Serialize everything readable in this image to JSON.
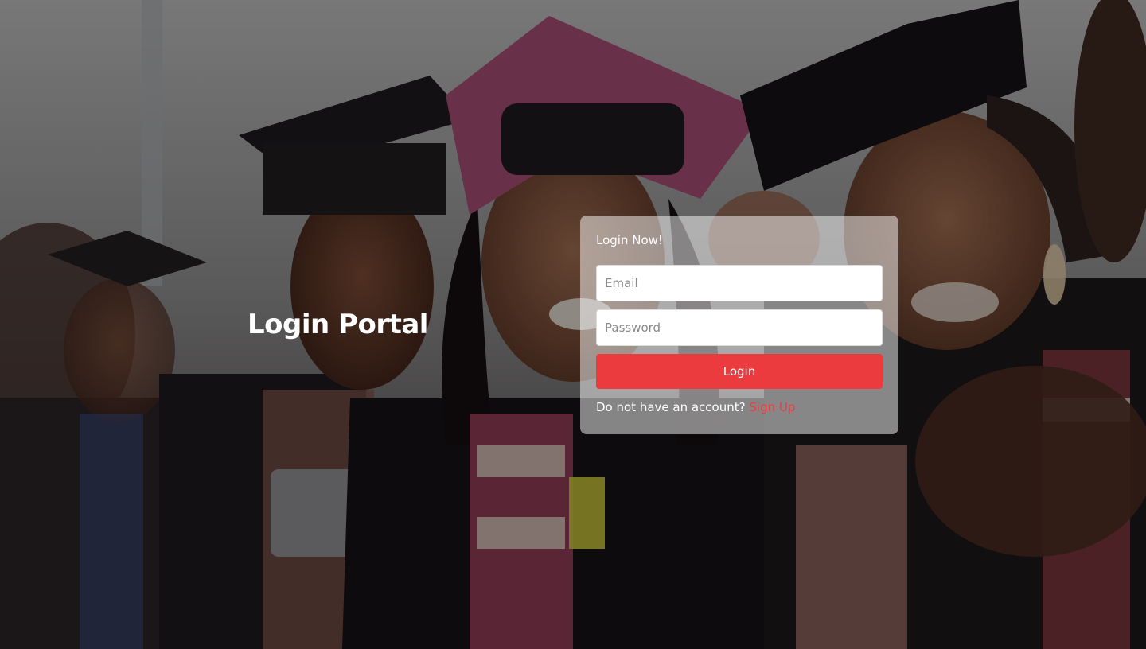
{
  "hero": {
    "title": "Login Portal"
  },
  "login_card": {
    "heading": "Login Now!",
    "email_placeholder": "Email",
    "password_placeholder": "Password",
    "submit_label": "Login",
    "signup_prompt": "Do not have an account?",
    "signup_link": "Sign Up"
  },
  "colors": {
    "accent": "#ec3b3f",
    "card_background": "rgba(255,255,255,0.5)"
  }
}
